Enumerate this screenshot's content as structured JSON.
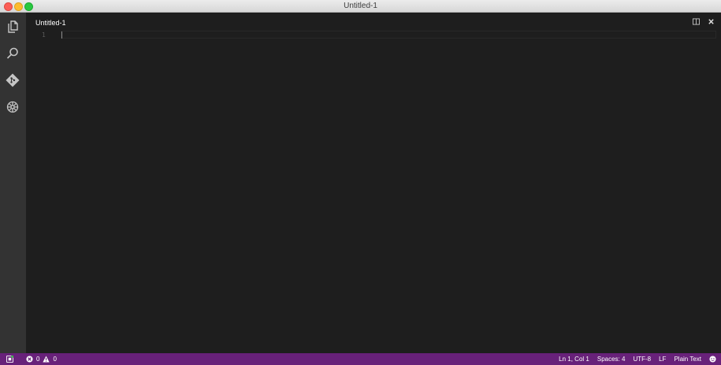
{
  "window": {
    "title": "Untitled-1"
  },
  "activity_bar": {
    "items": [
      {
        "icon": "files-icon"
      },
      {
        "icon": "search-icon"
      },
      {
        "icon": "git-icon"
      },
      {
        "icon": "debug-icon"
      }
    ]
  },
  "tabs": [
    {
      "label": "Untitled-1"
    }
  ],
  "editor": {
    "line_numbers": [
      "1"
    ]
  },
  "status_bar": {
    "errors": "0",
    "warnings": "0",
    "position": "Ln 1, Col 1",
    "indentation": "Spaces: 4",
    "encoding": "UTF-8",
    "eol": "LF",
    "language": "Plain Text"
  },
  "colors": {
    "status_bar": "#68217a",
    "activity_bar": "#333333",
    "editor_bg": "#1e1e1e"
  }
}
